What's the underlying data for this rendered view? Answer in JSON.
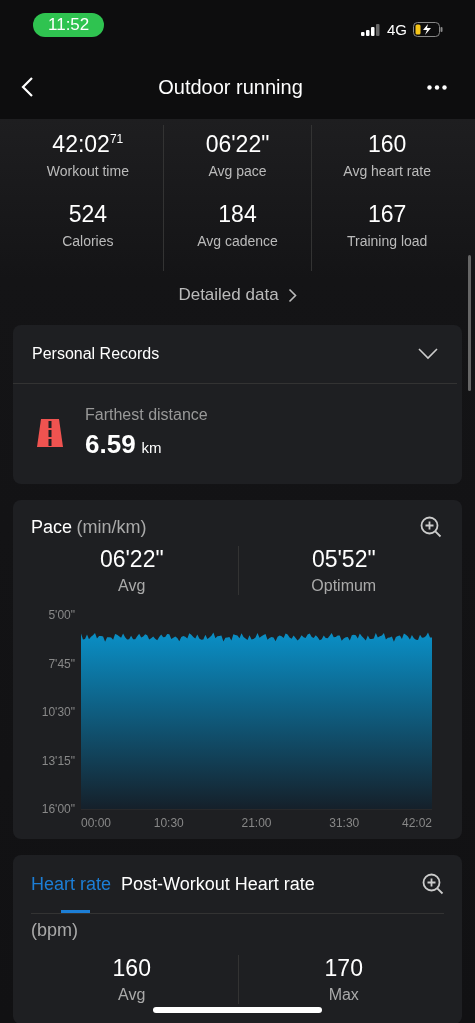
{
  "status_bar": {
    "time": "11:52",
    "network": "4G"
  },
  "header": {
    "title": "Outdoor running"
  },
  "summary": {
    "stats": [
      {
        "value": "42:02$^{71}$",
        "label": "Workout time"
      },
      {
        "value": "06'22\"",
        "label": "Avg pace"
      },
      {
        "value": "160",
        "label": "Avg heart rate"
      },
      {
        "value": "524",
        "label": "Calories"
      },
      {
        "value": "184",
        "label": "Avg cadence"
      },
      {
        "value": "167",
        "label": "Training load"
      }
    ],
    "detail_link": "Detailed data"
  },
  "personal_records": {
    "title": "Personal Records",
    "expanded": false,
    "records": [
      {
        "label": "Farthest distance",
        "value": "6.59",
        "unit": "km"
      }
    ]
  },
  "pace": {
    "title": "Pace",
    "unit": "(min/km)",
    "stats": [
      {
        "value": "06'22\"",
        "label": "Avg"
      },
      {
        "value": "05'52\"",
        "label": "Optimum"
      }
    ],
    "y_axis_labels": [
      "5'00\"",
      "7'45\"",
      "10'30\"",
      "13'15\"",
      "16'00\""
    ],
    "x_axis_labels": [
      "00:00",
      "10:30",
      "21:00",
      "31:30",
      "42:02"
    ]
  },
  "heart_rate": {
    "tabs": [
      {
        "label": "Heart rate",
        "selected": true
      },
      {
        "label": "Post-Workout Heart rate",
        "selected": false
      }
    ],
    "unit": "(bpm)",
    "stats": [
      {
        "value": "160",
        "label": "Avg"
      },
      {
        "value": "170",
        "label": "Max"
      }
    ]
  }
}
